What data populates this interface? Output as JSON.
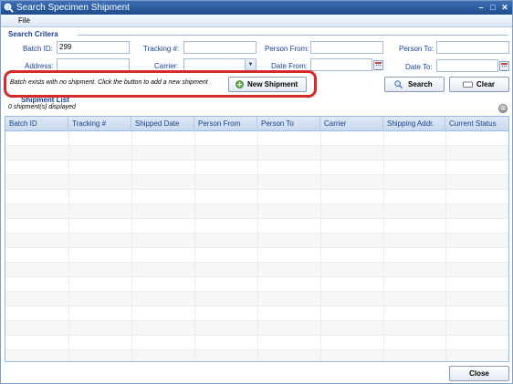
{
  "window": {
    "title": "Search Specimen Shipment"
  },
  "menu": {
    "file": "File"
  },
  "criteria": {
    "title": "Search Critera",
    "batch_id_label": "Batch ID:",
    "batch_id_value": "299",
    "tracking_label": "Tracking #:",
    "tracking_value": "",
    "person_from_label": "Person From:",
    "person_from_value": "",
    "person_to_label": "Person To:",
    "person_to_value": "",
    "address_label": "Address:",
    "address_value": "",
    "carrier_label": "Carrier:",
    "carrier_value": "",
    "date_from_label": "Date From:",
    "date_from_value": "",
    "date_to_label": "Date To:",
    "date_to_value": ""
  },
  "notice": {
    "text": "Batch exists with no shipment. Click the button to add a new shipment",
    "new_shipment_label": "New Shipment"
  },
  "actions": {
    "search_label": "Search",
    "clear_label": "Clear",
    "close_label": "Close"
  },
  "list": {
    "title": "Shipment List",
    "status": "0 shipment(s) displayed",
    "columns": [
      "Batch ID",
      "Tracking #",
      "Shipped Date",
      "Person From",
      "Person To",
      "Carrier",
      "Shipping Addr.",
      "Current Status"
    ]
  },
  "colors": {
    "title_bar": "#295b9f",
    "label": "#15428b",
    "highlight_border": "#d42a2a",
    "grid_border": "#99bbe8"
  },
  "icons": [
    "search-window-icon",
    "minimize-icon",
    "maximize-icon",
    "close-window-icon",
    "calendar-icon",
    "plus-circle-icon",
    "magnifier-icon",
    "eraser-icon",
    "collapse-icon"
  ]
}
